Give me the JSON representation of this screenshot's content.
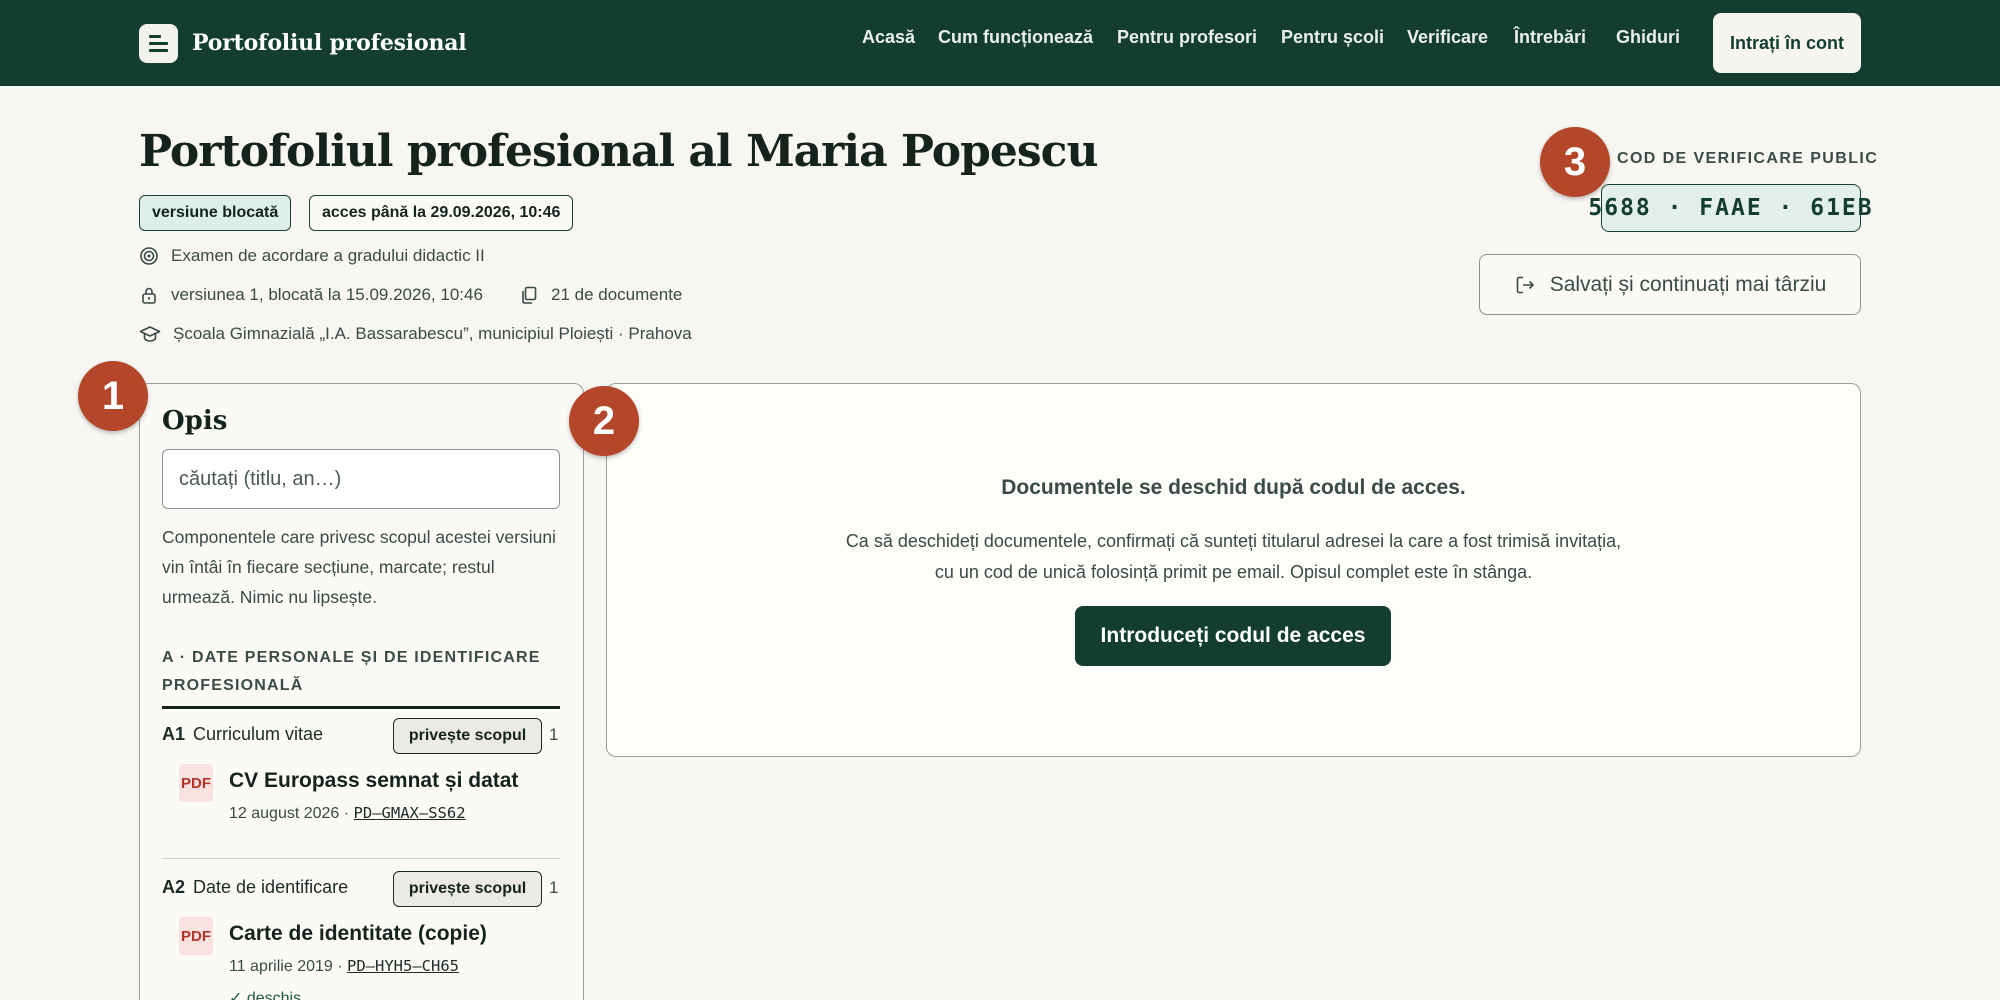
{
  "brand": {
    "name": "Portofoliul profesional",
    "icon": "document-lines-icon"
  },
  "nav": {
    "items": [
      {
        "label": "Acasă"
      },
      {
        "label": "Cum funcționează"
      },
      {
        "label": "Pentru profesori"
      },
      {
        "label": "Pentru școli"
      },
      {
        "label": "Verificare"
      },
      {
        "label": "Întrebări"
      },
      {
        "label": "Ghiduri"
      }
    ],
    "login_label": "Intrați în cont"
  },
  "header": {
    "title": "Portofoliul profesional al Maria Popescu",
    "badge_locked": "versiune blocată",
    "badge_access": "acces până la 29.09.2026, 10:46",
    "purpose": "Examen de acordare a gradului didactic II",
    "version": "versiunea 1, blocată la 15.09.2026, 10:46",
    "documents": "21 de documente",
    "school": "Școala Gimnazială „I.A. Bassarabescu”, municipiul Ploiești · Prahova"
  },
  "verification": {
    "label": "COD DE VERIFICARE PUBLIC",
    "code": "5688 · FAAE · 61EB"
  },
  "save_label": "Salvați și continuați mai târziu",
  "markers": [
    "1",
    "2",
    "3"
  ],
  "opis": {
    "title": "Opis",
    "search_placeholder": "căutați (titlu, an…)",
    "description": "Componentele care privesc scopul acestei versiuni vin întâi în fiecare secțiune, marcate; restul urmează. Nimic nu lipsește.",
    "section": {
      "title": "A · DATE PERSONALE ȘI DE IDENTIFICARE PROFESIONALĂ",
      "items": [
        {
          "code": "A1",
          "name": "Curriculum vitae",
          "badge": "privește scopul",
          "count": "1",
          "doc_type": "PDF",
          "doc_title": "CV Europass semnat și datat",
          "date": "12 august 2026 ·",
          "ref": "PD–GMAX–SS62"
        },
        {
          "code": "A2",
          "name": "Date de identificare",
          "badge": "privește scopul",
          "count": "1",
          "doc_type": "PDF",
          "doc_title": "Carte de identitate (copie)",
          "date": "11 aprilie 2019 ·",
          "ref": "PD–HYH5–CH65",
          "status": "✓ deschis"
        }
      ]
    }
  },
  "panel": {
    "heading": "Documentele se deschid după codul de acces.",
    "text_line1": "Ca să deschideți documentele, confirmați că sunteți titularul adresei la care a fost trimisă invitația,",
    "text_line2": "cu un cod de unică folosință primit pe email. Opisul complet este în stânga.",
    "button": "Introduceți codul de acces"
  },
  "colors": {
    "brand_green": "#123d30",
    "background": "#f7f6f2",
    "marker": "#b4462a",
    "pdf_red": "#b2352b"
  }
}
